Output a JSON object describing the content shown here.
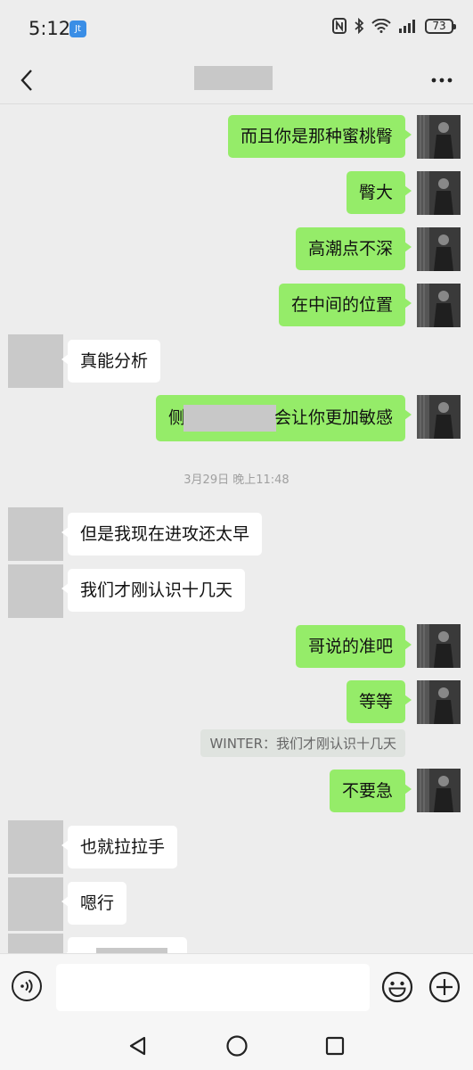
{
  "status_bar": {
    "time": "5:12",
    "app_badge": "Jt",
    "battery": "73"
  },
  "header": {
    "title": "",
    "back_icon": "back-arrow-icon",
    "more_icon": "more-dots-icon"
  },
  "messages": [
    {
      "side": "right",
      "text": "而且你是那种蜜桃臀"
    },
    {
      "side": "right",
      "text": "臀大"
    },
    {
      "side": "right",
      "text": "高潮点不深"
    },
    {
      "side": "right",
      "text": "在中间的位置"
    },
    {
      "side": "left",
      "text": "真能分析"
    },
    {
      "side": "right",
      "text_before": "侧",
      "text_after": "会让你更加敏感"
    },
    {
      "type": "timestamp",
      "text": "3月29日 晚上11:48"
    },
    {
      "side": "left",
      "text": "但是我现在进攻还太早"
    },
    {
      "side": "left",
      "text": "我们才刚认识十几天"
    },
    {
      "side": "right",
      "text": "哥说的准吧"
    },
    {
      "side": "right",
      "text": "等等"
    },
    {
      "type": "quote",
      "text": "WINTER：我们才刚认识十几天"
    },
    {
      "side": "right",
      "text": "不要急"
    },
    {
      "side": "left",
      "text": "也就拉拉手"
    },
    {
      "side": "left",
      "text": "嗯行"
    },
    {
      "side": "left",
      "text": ""
    }
  ],
  "input": {
    "placeholder": "",
    "voice_icon": "voice-icon",
    "emoji_icon": "emoji-icon",
    "plus_icon": "plus-icon"
  },
  "colors": {
    "bubble_self": "#95ec69",
    "bubble_other": "#ffffff",
    "background": "#ededed"
  }
}
